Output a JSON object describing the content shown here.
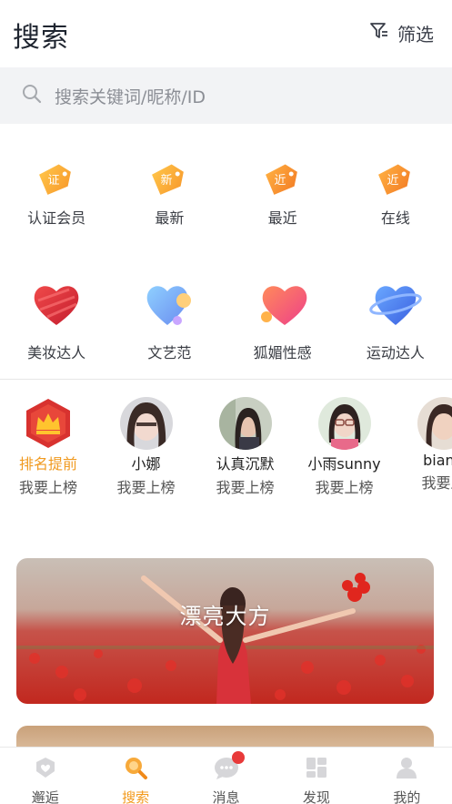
{
  "header": {
    "title": "搜索",
    "filter_label": "筛选"
  },
  "search": {
    "placeholder": "搜索关键词/昵称/ID"
  },
  "categories_row1": [
    {
      "label": "认证会员",
      "tag": "证",
      "icon": "certified-tag-icon"
    },
    {
      "label": "最新",
      "tag": "新",
      "icon": "new-tag-icon"
    },
    {
      "label": "最近",
      "tag": "近",
      "icon": "nearby-tag-icon"
    },
    {
      "label": "在线",
      "tag": "近",
      "icon": "online-tag-icon"
    }
  ],
  "categories_row2": [
    {
      "label": "美妆达人",
      "icon": "heart-red-icon"
    },
    {
      "label": "文艺范",
      "icon": "heart-blue-icon"
    },
    {
      "label": "狐媚性感",
      "icon": "heart-pink-icon"
    },
    {
      "label": "运动达人",
      "icon": "heart-planet-icon"
    }
  ],
  "ranking": [
    {
      "name": "排名提前",
      "sub": "我要上榜",
      "icon": "crown-icon"
    },
    {
      "name": "小娜",
      "sub": "我要上榜"
    },
    {
      "name": "认真沉默",
      "sub": "我要上榜"
    },
    {
      "name": "小雨sunny",
      "sub": "我要上榜"
    },
    {
      "name": "bianp",
      "sub": "我要上"
    }
  ],
  "banner": {
    "text": "漂亮大方"
  },
  "tabs": [
    {
      "label": "邂逅",
      "icon": "encounter-icon"
    },
    {
      "label": "搜索",
      "icon": "search-tab-icon",
      "active": true
    },
    {
      "label": "消息",
      "icon": "message-icon",
      "badge": true
    },
    {
      "label": "发现",
      "icon": "discover-icon"
    },
    {
      "label": "我的",
      "icon": "profile-icon"
    }
  ],
  "colors": {
    "accent": "#f39a1c",
    "badge": "#e83a3a",
    "search_bg": "#f2f3f5"
  }
}
